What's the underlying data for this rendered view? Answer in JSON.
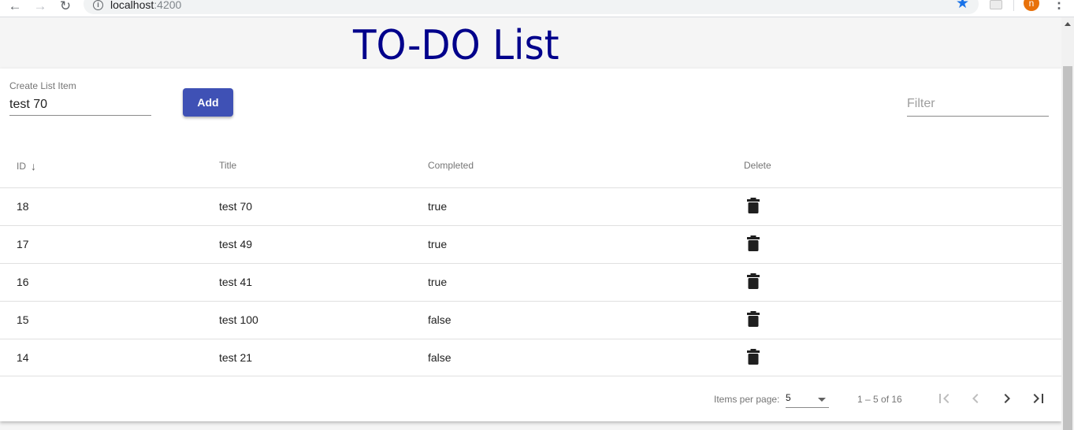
{
  "browser": {
    "url_host": "localhost",
    "url_port": ":4200",
    "profile_initial": "n"
  },
  "page": {
    "title": "TO-DO List"
  },
  "form": {
    "create_label": "Create List Item",
    "create_value": "test 70",
    "add_label": "Add",
    "filter_placeholder": "Filter"
  },
  "table": {
    "headers": {
      "id": "ID",
      "title": "Title",
      "completed": "Completed",
      "delete": "Delete"
    },
    "sort": {
      "column": "ID",
      "direction": "descending"
    },
    "rows": [
      {
        "id": "18",
        "title": "test 70",
        "completed": "true"
      },
      {
        "id": "17",
        "title": "test 49",
        "completed": "true"
      },
      {
        "id": "16",
        "title": "test 41",
        "completed": "true"
      },
      {
        "id": "15",
        "title": "test 100",
        "completed": "false"
      },
      {
        "id": "14",
        "title": "test 21",
        "completed": "false"
      }
    ]
  },
  "paginator": {
    "items_per_page_label": "Items per page:",
    "items_per_page_value": "5",
    "range_label": "1 – 5 of 16"
  },
  "colors": {
    "title": "#00008b",
    "primary_button": "#3f51b5",
    "avatar": "#e8710a",
    "star": "#1a73e8"
  }
}
